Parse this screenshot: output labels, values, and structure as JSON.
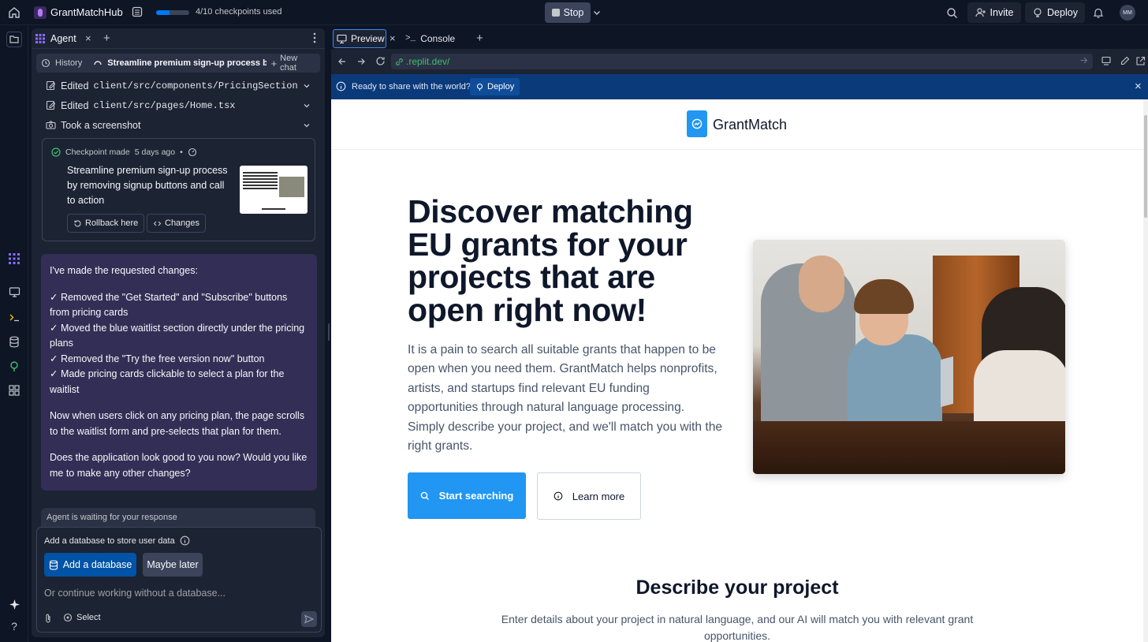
{
  "topbar": {
    "app_name": "GrantMatchHub",
    "checkpoints": "4/10 checkpoints used",
    "checkpoint_progress": 0.4,
    "stop_label": "Stop",
    "invite_label": "Invite",
    "deploy_label": "Deploy",
    "avatar_initials": "MM"
  },
  "agent": {
    "tab_label": "Agent",
    "history_label": "History",
    "chat_title": "Streamline premium sign-up process by ...",
    "new_chat_label": "New chat",
    "actions": [
      {
        "prefix": "Edited",
        "path": "client/src/components/PricingSection...."
      },
      {
        "prefix": "Edited",
        "path": "client/src/pages/Home.tsx"
      },
      {
        "prefix": "Took a screenshot",
        "path": ""
      }
    ],
    "checkpoint": {
      "made_label": "Checkpoint made",
      "time": "5 days ago",
      "dot": "•",
      "title": "Streamline premium sign-up process by removing signup buttons and call to action",
      "rollback_label": "Rollback here",
      "changes_label": "Changes"
    },
    "message": {
      "intro": "I've made the requested changes:",
      "items": [
        "✓ Removed the \"Get Started\" and \"Subscribe\" buttons from pricing cards",
        "✓ Moved the blue waitlist section directly under the pricing plans",
        "✓ Removed the \"Try the free version now\" button",
        "✓ Made pricing cards clickable to select a plan for the waitlist"
      ],
      "para2": "Now when users click on any pricing plan, the page scrolls to the waitlist form and pre-selects that plan for them.",
      "para3": "Does the application look good to you now? Would you like me to make any other changes?"
    },
    "waiting_label": "Agent is waiting for your response",
    "db_prompt": "Add a database to store user data",
    "add_db_label": "Add a database",
    "maybe_later_label": "Maybe later",
    "input_placeholder": "Or continue working without a database...",
    "select_label": "Select"
  },
  "preview": {
    "tab_preview": "Preview",
    "tab_console": "Console",
    "url": ".replit.dev/",
    "banner_text": "Ready to share with the world?",
    "banner_deploy": "Deploy"
  },
  "site": {
    "brand": "GrantMatch",
    "hero_title": "Discover matching EU grants for your projects that are open right now!",
    "hero_text": "It is a pain to search all suitable grants that happen to be open when you need them. GrantMatch helps nonprofits, artists, and startups find relevant EU funding opportunities through natural language processing. Simply describe your project, and we'll match you with the right grants.",
    "start_label": "Start searching",
    "learn_label": "Learn more",
    "section_title": "Describe your project",
    "section_text": "Enter details about your project in natural language, and our AI will match you with relevant grant opportunities."
  },
  "colors": {
    "bg": "#0e1525",
    "panel": "#1c2333",
    "accent": "#0079f2",
    "message_bg": "#332e55",
    "site_primary": "#2196f3",
    "banner": "#0b3a7a"
  }
}
